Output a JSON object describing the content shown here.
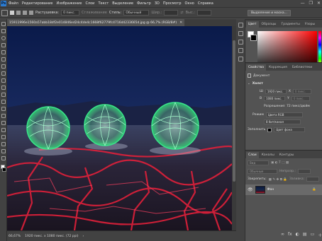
{
  "menubar": {
    "logo": "Ps",
    "items": [
      "Файл",
      "Редактирование",
      "Изображение",
      "Слои",
      "Текст",
      "Выделение",
      "Фильтр",
      "3D",
      "Просмотр",
      "Окно",
      "Справка"
    ],
    "win_minimize": "—",
    "win_restore": "❐",
    "win_close": "✕"
  },
  "options": {
    "feather_label": "Растушевка:",
    "feather_value": "0 пикс.",
    "antialias_label": "Сглаживание",
    "style_label": "Стиль:",
    "style_value": "Обычный",
    "width_label": "Шир.:",
    "height_label": "Выс.:",
    "select_mask_button": "Выделение и маска..."
  },
  "document": {
    "tab_title": "15911996e1560a57abb18df2e014846ed24c4de4c1668f62779fc4716d4233665d.jpg @ 66,7% (RGB/8#)",
    "close_glyph": "✕"
  },
  "status": {
    "zoom": "66,67%",
    "size": "1920 пикс. х 1080 пикс. (72 ppi)",
    "arrow": "›"
  },
  "color_panel": {
    "tabs": [
      "Цвет",
      "Образцы",
      "Градиенты",
      "Узоры"
    ],
    "colors": {
      "fg": "#ffffff",
      "bg": "#000000",
      "hue": "#ff0000"
    }
  },
  "properties_panel": {
    "tabs": [
      "Свойства",
      "Коррекция",
      "Библиотеки"
    ],
    "doc_label": "Документ",
    "canvas_title": "Холст",
    "width_label": "Ш",
    "width_value": "1920 пикс.",
    "x_label": "X",
    "x_value": "0 пикс.",
    "height_label": "В",
    "height_value": "1080 пикс.",
    "y_label": "Y",
    "y_value": "0 пикс.",
    "resolution": "Разрешение: 72 пикс/дюйм",
    "mode_label": "Режим",
    "mode_value": "Цвета RGB",
    "bits_value": "8 бит/канал",
    "fill_label": "Заполнить",
    "fill_value": "Цвет фона"
  },
  "layers_panel": {
    "tabs": [
      "Слои",
      "Каналы",
      "Контуры"
    ],
    "filter_placeholder": "Вид",
    "blend_mode": "Обычные",
    "opacity_label": "Непрозр.:",
    "lock_label": "Закрепить:",
    "fill_label": "Заливка:",
    "layer_name": "Фон",
    "bottom_icons": [
      "∞",
      "fx",
      "◐",
      "▤",
      "▭",
      "＋",
      "🗑"
    ]
  }
}
